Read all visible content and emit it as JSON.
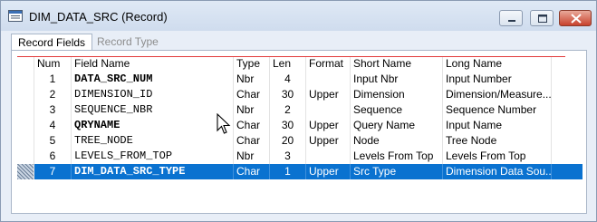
{
  "window": {
    "title": "DIM_DATA_SRC (Record)",
    "accent_color": "#0a72d0"
  },
  "tabs": [
    {
      "label": "Record Fields",
      "active": true
    },
    {
      "label": "Record Type",
      "active": false
    }
  ],
  "columns": {
    "num": "Num",
    "field_name": "Field Name",
    "type": "Type",
    "len": "Len",
    "format": "Format",
    "short_name": "Short Name",
    "long_name": "Long Name"
  },
  "rows": [
    {
      "num": "1",
      "field_name": "DATA_SRC_NUM",
      "type": "Nbr",
      "len": "4",
      "format": "",
      "short_name": "Input Nbr",
      "long_name": "Input Number",
      "bold": true
    },
    {
      "num": "2",
      "field_name": "DIMENSION_ID",
      "type": "Char",
      "len": "30",
      "format": "Upper",
      "short_name": "Dimension",
      "long_name": "Dimension/Measure...",
      "bold": false
    },
    {
      "num": "3",
      "field_name": "SEQUENCE_NBR",
      "type": "Nbr",
      "len": "2",
      "format": "",
      "short_name": "Sequence",
      "long_name": "Sequence Number",
      "bold": false
    },
    {
      "num": "4",
      "field_name": "QRYNAME",
      "type": "Char",
      "len": "30",
      "format": "Upper",
      "short_name": "Query Name",
      "long_name": "Input Name",
      "bold": true
    },
    {
      "num": "5",
      "field_name": "TREE_NODE",
      "type": "Char",
      "len": "20",
      "format": "Upper",
      "short_name": "Node",
      "long_name": "Tree Node",
      "bold": false
    },
    {
      "num": "6",
      "field_name": "LEVELS_FROM_TOP",
      "type": "Nbr",
      "len": "3",
      "format": "",
      "short_name": "Levels From Top",
      "long_name": "Levels From Top",
      "bold": false
    },
    {
      "num": "7",
      "field_name": "DIM_DATA_SRC_TYPE",
      "type": "Char",
      "len": "1",
      "format": "Upper",
      "short_name": "Src Type",
      "long_name": "Dimension Data Sou...",
      "bold": true,
      "selected": true
    }
  ]
}
